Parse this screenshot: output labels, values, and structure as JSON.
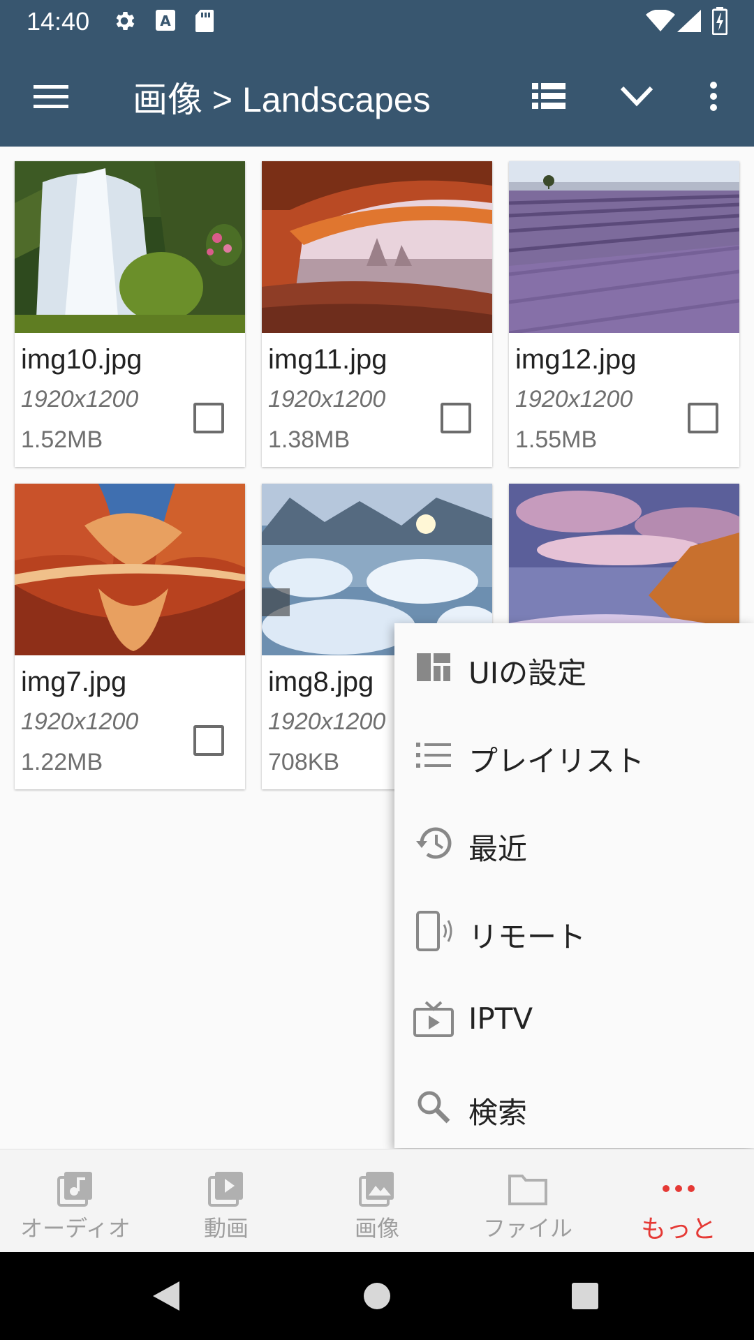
{
  "status_bar": {
    "time": "14:40",
    "icons": [
      "settings-icon",
      "font-a-icon",
      "sd-card-icon",
      "wifi-icon",
      "cell-signal-icon",
      "battery-charging-icon"
    ]
  },
  "app_bar": {
    "title": "画像 > Landscapes",
    "icons": [
      "hamburger-menu-icon",
      "list-view-icon",
      "chevron-down-icon",
      "more-vert-icon"
    ]
  },
  "grid": {
    "items": [
      {
        "name": "img10.jpg",
        "resolution": "1920x1200",
        "size": "1.52MB",
        "checked": false
      },
      {
        "name": "img11.jpg",
        "resolution": "1920x1200",
        "size": "1.38MB",
        "checked": false
      },
      {
        "name": "img12.jpg",
        "resolution": "1920x1200",
        "size": "1.55MB",
        "checked": false
      },
      {
        "name": "img7.jpg",
        "resolution": "1920x1200",
        "size": "1.22MB",
        "checked": false
      },
      {
        "name": "img8.jpg",
        "resolution": "1920x1200",
        "size": "708KB",
        "checked": false
      }
    ]
  },
  "menu": {
    "items": [
      {
        "label": "UIの設定",
        "icon": "dashboard-layout-icon"
      },
      {
        "label": "プレイリスト",
        "icon": "playlist-icon"
      },
      {
        "label": "最近",
        "icon": "history-icon"
      },
      {
        "label": "リモート",
        "icon": "remote-device-icon"
      },
      {
        "label": "IPTV",
        "icon": "tv-icon"
      },
      {
        "label": "検索",
        "icon": "search-icon"
      }
    ]
  },
  "bottom_nav": {
    "items": [
      {
        "label": "オーディオ",
        "icon": "audio-library-icon",
        "active": false
      },
      {
        "label": "動画",
        "icon": "video-library-icon",
        "active": false
      },
      {
        "label": "画像",
        "icon": "image-library-icon",
        "active": false
      },
      {
        "label": "ファイル",
        "icon": "folder-icon",
        "active": false
      },
      {
        "label": "もっと",
        "icon": "more-horiz-icon",
        "active": true
      }
    ],
    "colors": {
      "inactive": "#9e9e9e",
      "active": "#e53935"
    }
  },
  "colors": {
    "app_bar": "#38566f",
    "background": "#fafafa"
  }
}
